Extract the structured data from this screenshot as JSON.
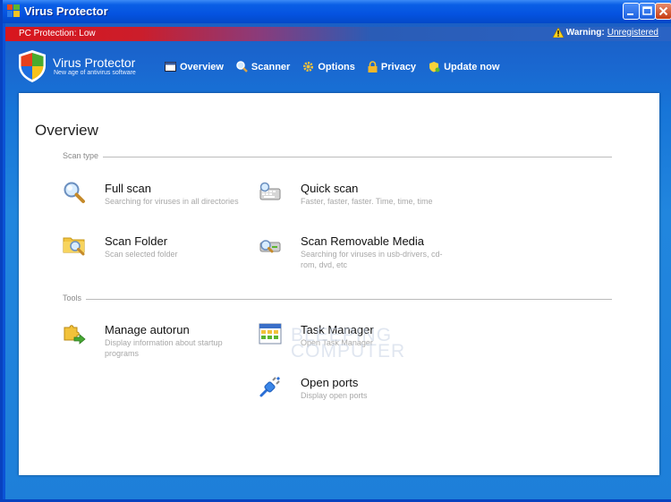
{
  "window": {
    "title": "Virus Protector"
  },
  "status": {
    "protection": "PC Protection: Low",
    "warning_label": "Warning:",
    "warning_link": "Unregistered"
  },
  "brand": {
    "name": "Virus Protector",
    "tagline": "New age of antivirus software"
  },
  "nav": [
    {
      "label": "Overview",
      "icon": "window-icon"
    },
    {
      "label": "Scanner",
      "icon": "magnifier-icon"
    },
    {
      "label": "Options",
      "icon": "gear-icon"
    },
    {
      "label": "Privacy",
      "icon": "lock-icon"
    },
    {
      "label": "Update now",
      "icon": "update-shield-icon"
    }
  ],
  "overview": {
    "title": "Overview",
    "scan_section": "Scan type",
    "tools_section": "Tools",
    "scan_items": [
      {
        "name": "Full scan",
        "desc": "Searching for viruses in all directories",
        "icon": "magnifier-icon"
      },
      {
        "name": "Quick scan",
        "desc": "Faster, faster, faster. Time, time, time",
        "icon": "keyboard-magnifier-icon"
      },
      {
        "name": "Scan Folder",
        "desc": "Scan selected folder",
        "icon": "folder-magnifier-icon"
      },
      {
        "name": "Scan Removable Media",
        "desc": "Searching for viruses in usb-drivers, cd-rom, dvd, etc",
        "icon": "drive-magnifier-icon"
      }
    ],
    "tool_items": [
      {
        "name": "Manage autorun",
        "desc": "Display information about startup programs",
        "icon": "puzzle-arrow-icon"
      },
      {
        "name": "Task Manager",
        "desc": "Open Task Manager",
        "icon": "task-manager-icon"
      },
      {
        "name": "Open ports",
        "desc": "Display open ports",
        "icon": "plug-icon"
      }
    ]
  },
  "watermark": {
    "line1": "BLEEPING",
    "line2": "COMPUTER"
  },
  "colors": {
    "accent": "#1a66cf",
    "warning_red": "#d8161d",
    "panel": "#ffffff"
  }
}
